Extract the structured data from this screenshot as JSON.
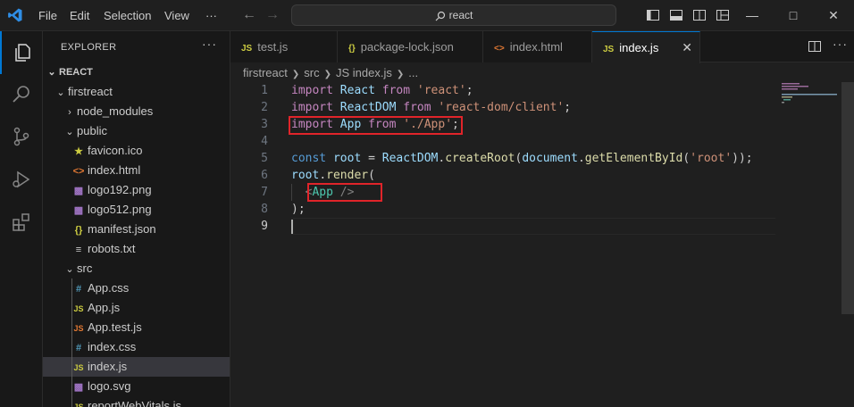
{
  "menu": [
    "File",
    "Edit",
    "Selection",
    "View",
    "···"
  ],
  "search": {
    "text": "react"
  },
  "explorer": {
    "title": "EXPLORER",
    "more": "···",
    "root": "REACT",
    "items": [
      {
        "label": "firstreact",
        "type": "folder-open",
        "icon": ""
      },
      {
        "label": "node_modules",
        "type": "folder-closed",
        "icon": ""
      },
      {
        "label": "public",
        "type": "folder-open",
        "icon": ""
      },
      {
        "label": "favicon.ico",
        "type": "file",
        "icon": "star-icon"
      },
      {
        "label": "index.html",
        "type": "file",
        "icon": "html-icon"
      },
      {
        "label": "logo192.png",
        "type": "file",
        "icon": "image-icon"
      },
      {
        "label": "logo512.png",
        "type": "file",
        "icon": "image-icon"
      },
      {
        "label": "manifest.json",
        "type": "file",
        "icon": "json-icon"
      },
      {
        "label": "robots.txt",
        "type": "file",
        "icon": "text-file-icon"
      },
      {
        "label": "src",
        "type": "folder-open",
        "icon": ""
      },
      {
        "label": "App.css",
        "type": "file",
        "icon": "css-icon"
      },
      {
        "label": "App.js",
        "type": "file",
        "icon": "js-icon"
      },
      {
        "label": "App.test.js",
        "type": "file",
        "icon": "test-js-icon"
      },
      {
        "label": "index.css",
        "type": "file",
        "icon": "css-icon"
      },
      {
        "label": "index.js",
        "type": "file",
        "icon": "js-icon"
      },
      {
        "label": "logo.svg",
        "type": "file",
        "icon": "svg-icon"
      },
      {
        "label": "reportWebVitals.js",
        "type": "file",
        "icon": "js-icon"
      }
    ]
  },
  "tabs": [
    {
      "label": "test.js",
      "badge": "JS",
      "active": false
    },
    {
      "label": "package-lock.json",
      "badge": "{}",
      "active": false
    },
    {
      "label": "index.html",
      "badge": "<>",
      "active": false
    },
    {
      "label": "index.js",
      "badge": "JS",
      "active": true
    }
  ],
  "tab_close": "✕",
  "breadcrumb": [
    "firstreact",
    "src",
    "JS index.js",
    "..."
  ],
  "code_lines": [
    "import React from 'react';",
    "import ReactDOM from 'react-dom/client';",
    "import App from './App';",
    "",
    "const root = ReactDOM.createRoot(document.getElementById('root'));",
    "root.render(",
    "  <App />",
    ");",
    ""
  ],
  "line_numbers": [
    "1",
    "2",
    "3",
    "4",
    "5",
    "6",
    "7",
    "8",
    "9"
  ],
  "colors": {
    "accent": "#0078d4",
    "highlight_box": "#e0242a",
    "keyword": "#c586c0",
    "string": "#ce9178",
    "variable": "#9cdcfe",
    "function": "#dcdcaa",
    "component": "#4ec9b0"
  }
}
